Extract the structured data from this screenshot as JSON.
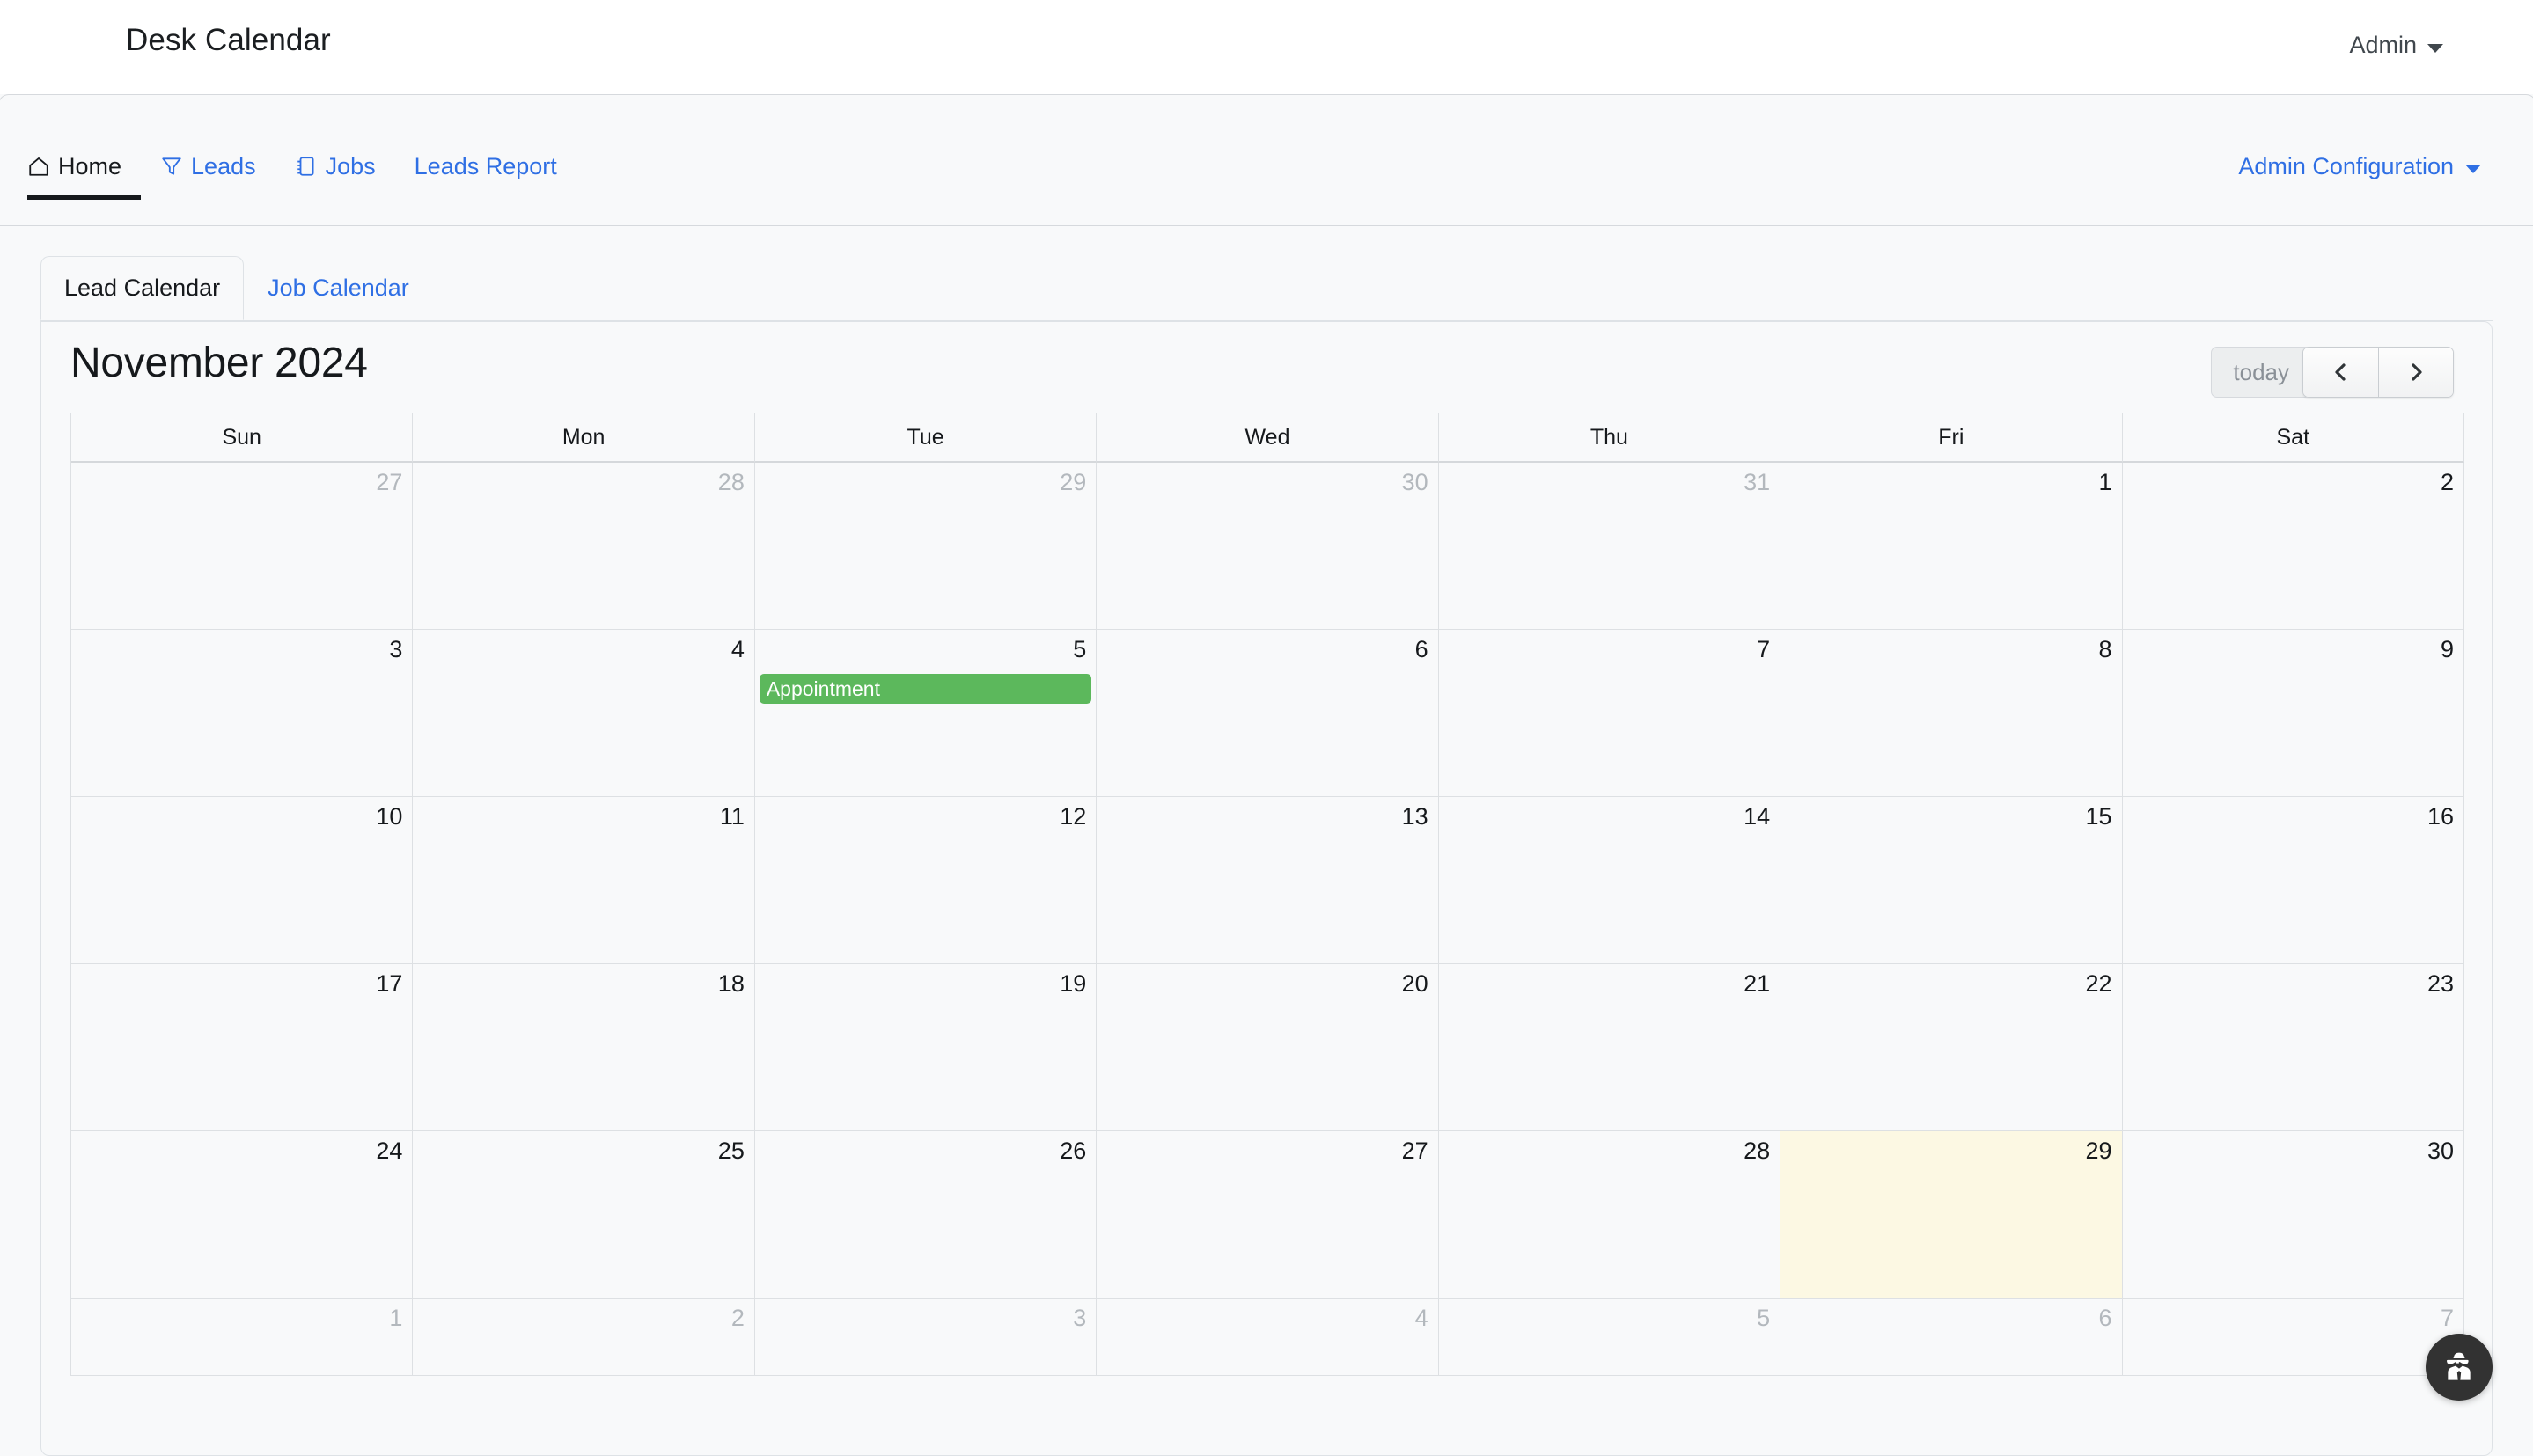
{
  "brand": {
    "title": "Desk Calendar",
    "user_label": "Admin",
    "user_caret_icon": "caret-down-icon"
  },
  "nav": {
    "items": [
      {
        "label": "Home",
        "icon": "home-icon",
        "active": true
      },
      {
        "label": "Leads",
        "icon": "filter-icon",
        "active": false
      },
      {
        "label": "Jobs",
        "icon": "journal-icon",
        "active": false
      },
      {
        "label": "Leads Report",
        "icon": "",
        "active": false
      }
    ],
    "admin_config_label": "Admin Configuration",
    "admin_config_icon": "caret-down-icon"
  },
  "tabs": [
    {
      "label": "Lead Calendar",
      "active": true
    },
    {
      "label": "Job Calendar",
      "active": false
    }
  ],
  "calendar": {
    "title": "November 2024",
    "today_button": "today",
    "prev_button_icon": "chevron-left-icon",
    "next_button_icon": "chevron-right-icon",
    "day_headers": [
      "Sun",
      "Mon",
      "Tue",
      "Wed",
      "Thu",
      "Fri",
      "Sat"
    ],
    "weeks": [
      [
        {
          "num": "27",
          "other": true,
          "today": false,
          "events": []
        },
        {
          "num": "28",
          "other": true,
          "today": false,
          "events": []
        },
        {
          "num": "29",
          "other": true,
          "today": false,
          "events": []
        },
        {
          "num": "30",
          "other": true,
          "today": false,
          "events": []
        },
        {
          "num": "31",
          "other": true,
          "today": false,
          "events": []
        },
        {
          "num": "1",
          "other": false,
          "today": false,
          "events": []
        },
        {
          "num": "2",
          "other": false,
          "today": false,
          "events": []
        }
      ],
      [
        {
          "num": "3",
          "other": false,
          "today": false,
          "events": []
        },
        {
          "num": "4",
          "other": false,
          "today": false,
          "events": []
        },
        {
          "num": "5",
          "other": false,
          "today": false,
          "events": [
            {
              "title": "Appointment",
              "color": "#5cb85c"
            }
          ]
        },
        {
          "num": "6",
          "other": false,
          "today": false,
          "events": []
        },
        {
          "num": "7",
          "other": false,
          "today": false,
          "events": []
        },
        {
          "num": "8",
          "other": false,
          "today": false,
          "events": []
        },
        {
          "num": "9",
          "other": false,
          "today": false,
          "events": []
        }
      ],
      [
        {
          "num": "10",
          "other": false,
          "today": false,
          "events": []
        },
        {
          "num": "11",
          "other": false,
          "today": false,
          "events": []
        },
        {
          "num": "12",
          "other": false,
          "today": false,
          "events": []
        },
        {
          "num": "13",
          "other": false,
          "today": false,
          "events": []
        },
        {
          "num": "14",
          "other": false,
          "today": false,
          "events": []
        },
        {
          "num": "15",
          "other": false,
          "today": false,
          "events": []
        },
        {
          "num": "16",
          "other": false,
          "today": false,
          "events": []
        }
      ],
      [
        {
          "num": "17",
          "other": false,
          "today": false,
          "events": []
        },
        {
          "num": "18",
          "other": false,
          "today": false,
          "events": []
        },
        {
          "num": "19",
          "other": false,
          "today": false,
          "events": []
        },
        {
          "num": "20",
          "other": false,
          "today": false,
          "events": []
        },
        {
          "num": "21",
          "other": false,
          "today": false,
          "events": []
        },
        {
          "num": "22",
          "other": false,
          "today": false,
          "events": []
        },
        {
          "num": "23",
          "other": false,
          "today": false,
          "events": []
        }
      ],
      [
        {
          "num": "24",
          "other": false,
          "today": false,
          "events": []
        },
        {
          "num": "25",
          "other": false,
          "today": false,
          "events": []
        },
        {
          "num": "26",
          "other": false,
          "today": false,
          "events": []
        },
        {
          "num": "27",
          "other": false,
          "today": false,
          "events": []
        },
        {
          "num": "28",
          "other": false,
          "today": false,
          "events": []
        },
        {
          "num": "29",
          "other": false,
          "today": true,
          "events": []
        },
        {
          "num": "30",
          "other": false,
          "today": false,
          "events": []
        }
      ],
      [
        {
          "num": "1",
          "other": true,
          "today": false,
          "events": []
        },
        {
          "num": "2",
          "other": true,
          "today": false,
          "events": []
        },
        {
          "num": "3",
          "other": true,
          "today": false,
          "events": []
        },
        {
          "num": "4",
          "other": true,
          "today": false,
          "events": []
        },
        {
          "num": "5",
          "other": true,
          "today": false,
          "events": []
        },
        {
          "num": "6",
          "other": true,
          "today": false,
          "events": []
        },
        {
          "num": "7",
          "other": true,
          "today": false,
          "events": []
        }
      ]
    ]
  },
  "fab": {
    "icon": "user-secret-icon"
  },
  "colors": {
    "link": "#2f6fe4",
    "event_green": "#5cb85c",
    "today_highlight": "#fcf8e3",
    "page_bg": "#f8f9fa",
    "fab_bg": "#323232"
  }
}
